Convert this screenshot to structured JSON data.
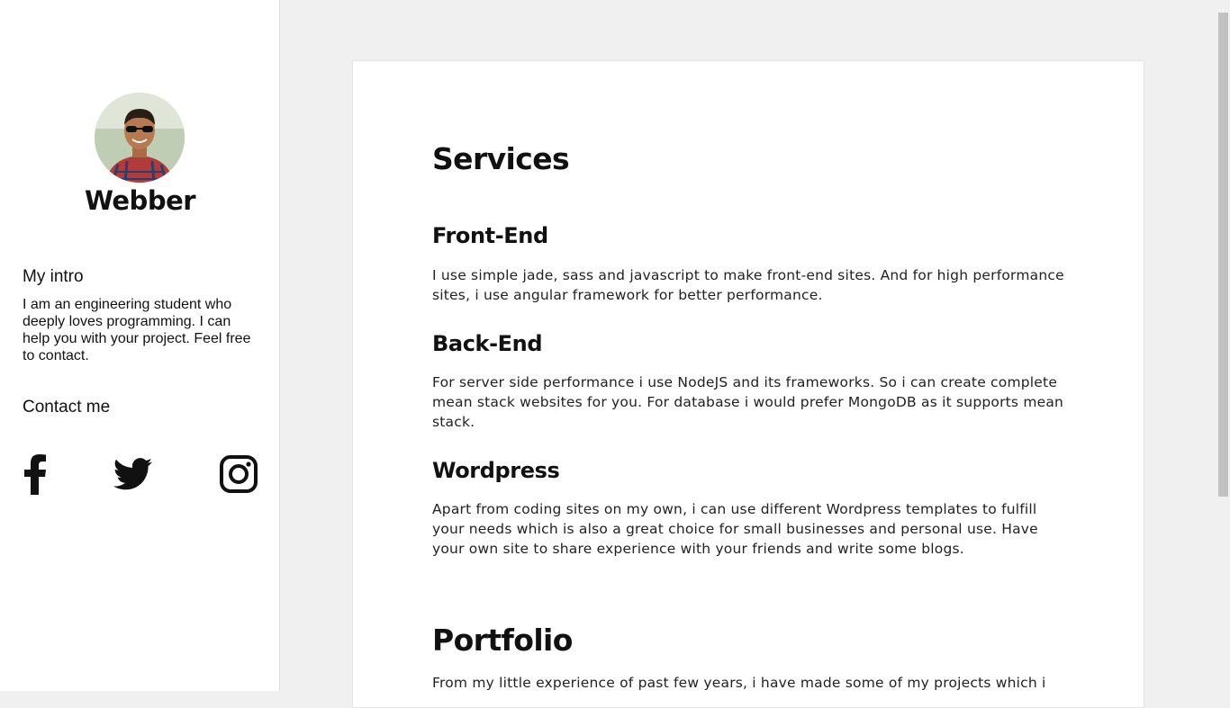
{
  "sidebar": {
    "name": "Webber",
    "intro_heading": "My intro",
    "intro_text": "I am an engineering student who deeply loves programming. I can help you with your project. Feel free to contact.",
    "contact_heading": "Contact me",
    "social_icons": [
      "facebook-icon",
      "twitter-icon",
      "instagram-icon"
    ]
  },
  "services": {
    "heading": "Services",
    "items": [
      {
        "title": "Front-End",
        "text": "I use simple jade, sass and javascript to make front-end sites. And for high performance sites, i use angular framework for better performance."
      },
      {
        "title": "Back-End",
        "text": "For server side performance i use NodeJS and its frameworks. So i can create complete mean stack websites for you. For database i would prefer MongoDB as it supports mean stack."
      },
      {
        "title": "Wordpress",
        "text": "Apart from coding sites on my own, i can use different Wordpress templates to fulfill your needs which is also a great choice for small businesses and personal use. Have your own site to share experience with your friends and write some blogs."
      }
    ]
  },
  "portfolio": {
    "heading": "Portfolio",
    "text": "From my little experience of past few years, i have made some of my projects which i"
  },
  "colors": {
    "background": "#f0f0f0",
    "card": "#ffffff",
    "text": "#111111"
  }
}
